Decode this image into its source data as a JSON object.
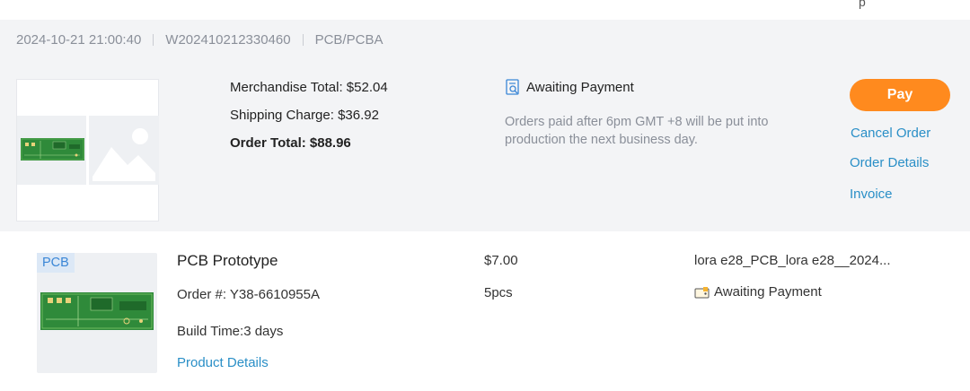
{
  "order": {
    "timestamp": "2024-10-21 21:00:40",
    "order_number": "W202410212330460",
    "category": "PCB/PCBA",
    "merchandise_total": "Merchandise Total: $52.04",
    "shipping_charge": "Shipping Charge: $36.92",
    "order_total": "Order Total: $88.96",
    "status": "Awaiting Payment",
    "status_note": "Orders paid after 6pm GMT +8 will be put into production the next business day.",
    "actions": {
      "pay": "Pay",
      "cancel": "Cancel Order",
      "details": "Order Details",
      "invoice": "Invoice"
    },
    "colors": {
      "pay_button": "#ff8a1e",
      "link": "#2a8fc7",
      "card_background": "#f3f4f6"
    }
  },
  "item": {
    "tag": "PCB",
    "title": "PCB Prototype",
    "order_no": "Order #: Y38-6610955A",
    "build_time": "Build Time:3 days",
    "details_link": "Product Details",
    "price": "$7.00",
    "quantity": "5pcs",
    "file_name": "lora e28_PCB_lora e28__2024...",
    "status": "Awaiting Payment"
  },
  "icons": {
    "order_status": "search-document-icon",
    "item_status": "wallet-icon",
    "placeholder": "image-placeholder-icon"
  }
}
